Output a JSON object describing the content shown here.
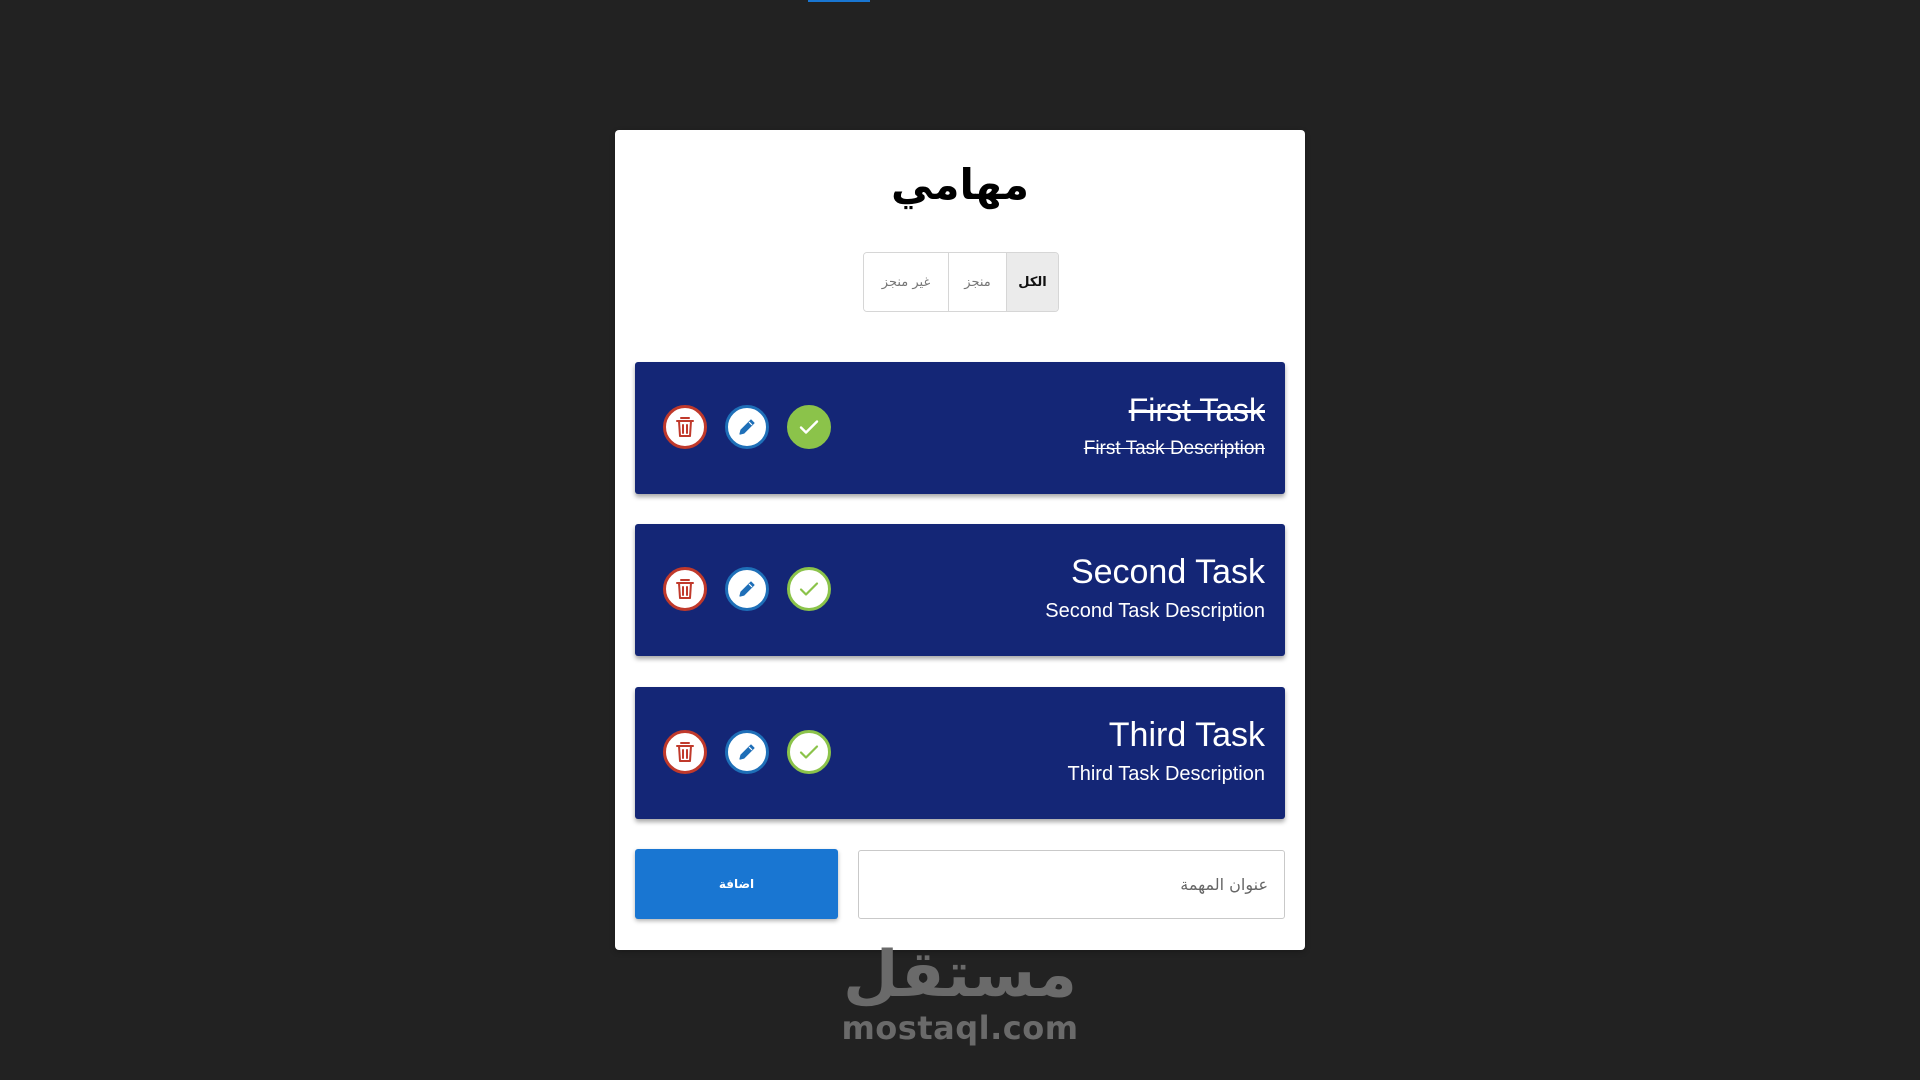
{
  "page": {
    "title": "مهامي"
  },
  "filters": [
    {
      "label": "الكل",
      "active": true
    },
    {
      "label": "منجز",
      "active": false
    },
    {
      "label": "غير منجز",
      "active": false
    }
  ],
  "tasks": [
    {
      "title": "First Task",
      "description": "First Task Description",
      "done": true
    },
    {
      "title": "Second Task",
      "description": "Second Task Description",
      "done": false
    },
    {
      "title": "Third Task",
      "description": "Third Task Description",
      "done": false
    }
  ],
  "icons": {
    "delete": "trash-icon",
    "edit": "pencil-icon",
    "complete": "check-icon"
  },
  "form": {
    "input_placeholder": "عنوان المهمة",
    "input_value": "",
    "add_label": "اضافة"
  },
  "watermark": {
    "arabic": "مستقل",
    "latin": "mostaql.com"
  },
  "colors": {
    "background": "#222222",
    "card": "#ffffff",
    "task_card": "#142676",
    "accent": "#1976d2",
    "delete": "#c0392b",
    "edit": "#1e6fb8",
    "done": "#8bc34a"
  }
}
